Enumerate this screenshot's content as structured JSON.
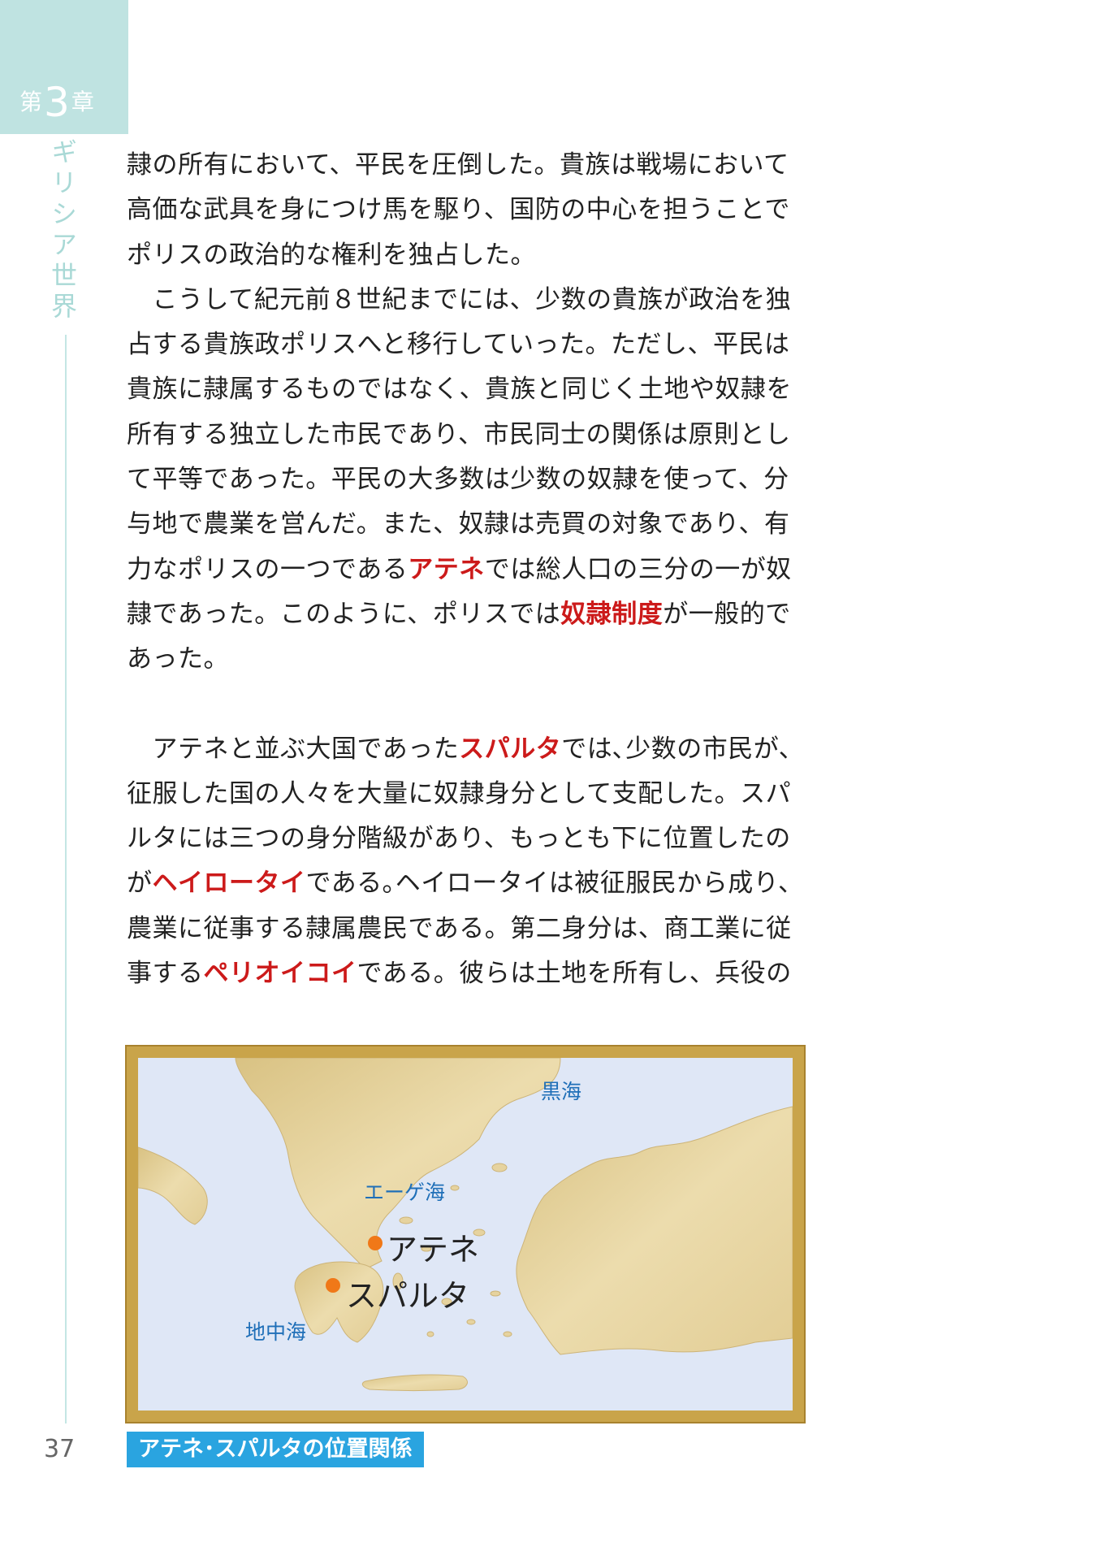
{
  "chapter": {
    "prefix": "第",
    "number": "3",
    "suffix": "章",
    "title": "ギリシア世界"
  },
  "page_number": "37",
  "body": {
    "p1": {
      "text": "隷の所有において、平民を圧倒した。貴族は戦場において高価な武具を身につけ馬を駆り、国防の中心を担うことでポリスの政治的な権利を独占した。"
    },
    "p2": {
      "a": "　こうして紀元前８世紀までには、少数の貴族が政治を独占する貴族政ポリスへと移行していった。ただし、平民は貴族に隷属するものではなく、貴族と同じく土地や奴隷を所有する独立した市民であり、市民同士の関係は原則として平等であった。平民の大多数は少数の奴隷を使って、分与地で農業を営んだ。また、奴隷は売買の対象であり、有力なポリスの一つである",
      "k1": "アテネ",
      "b": "では総人口の三分の一が奴隷であった。このように、ポリスでは",
      "k2": "奴隷制度",
      "c": "が一般的であった。"
    },
    "p3": {
      "a": "　アテネと並ぶ大国であった",
      "k1": "スパルタ",
      "b": "では､少数の市民が、征服した国の人々を大量に奴隷身分として支配した。スパルタには三つの身分階級があり、もっとも下に位置したのが",
      "k2": "ヘイロータイ",
      "c": "である｡ヘイロータイは被征服民から成り、農業に従事する隷属農民である。第二身分は、商工業に従事する",
      "k3": "ペリオイコイ",
      "d": "である。彼らは土地を所有し、兵役の"
    }
  },
  "map": {
    "labels": {
      "black_sea": "黒海",
      "aegean_sea": "エーゲ海",
      "mediterranean": "地中海",
      "athens": "アテネ",
      "sparta": "スパルタ"
    },
    "colors": {
      "sea": "#dfe7f6",
      "land": "#e6d39f",
      "frame": "#c9a44a",
      "marker": "#f07818"
    }
  },
  "caption": "アテネ･スパルタの位置関係",
  "colors": {
    "accent_teal": "#bfe3e1",
    "keyword_red": "#cc1a1a",
    "caption_blue": "#2aa4e0"
  }
}
